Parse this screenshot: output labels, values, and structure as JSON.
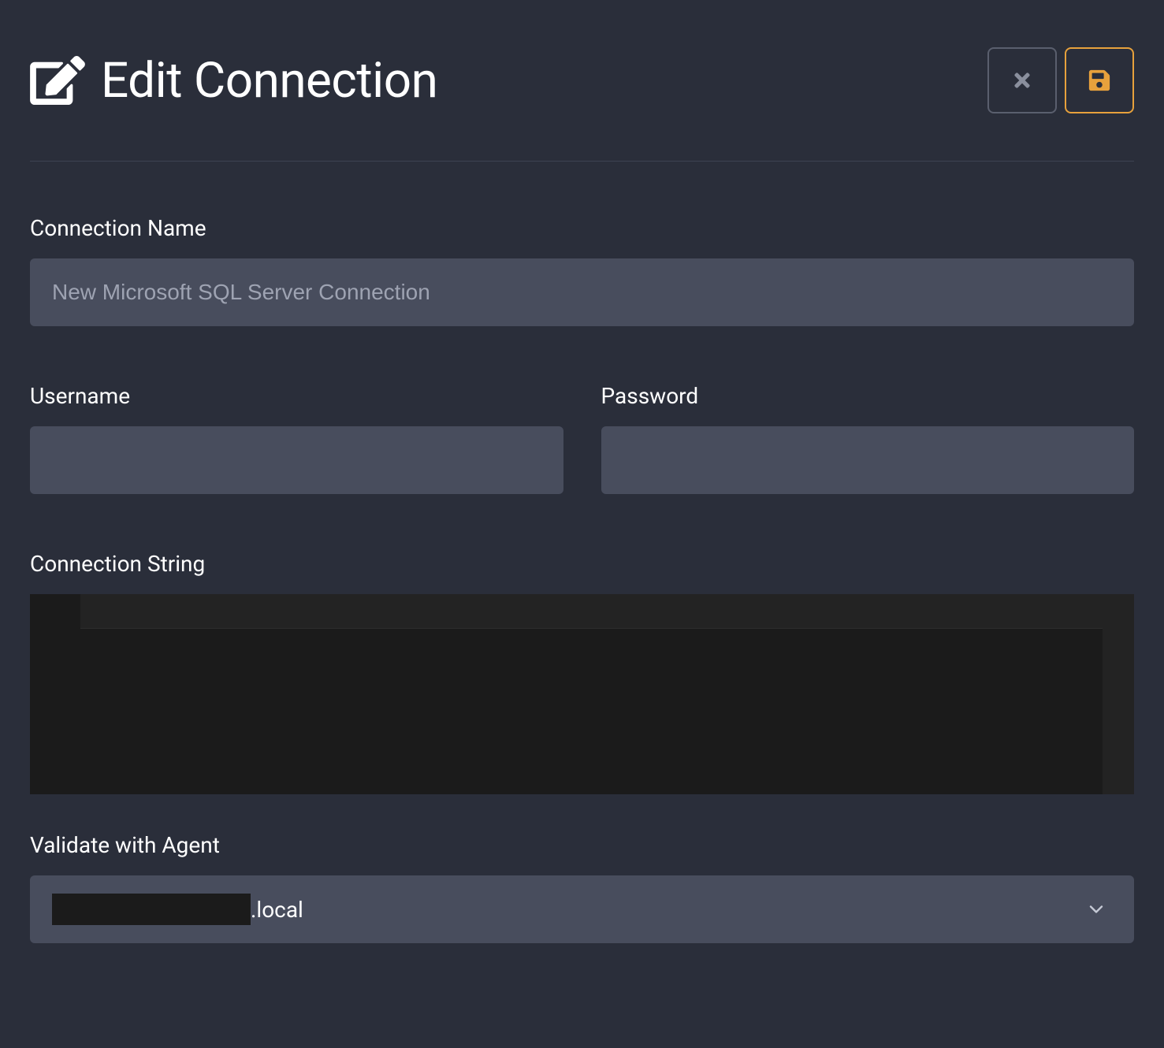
{
  "header": {
    "title": "Edit Connection"
  },
  "form": {
    "connectionName": {
      "label": "Connection Name",
      "value": "",
      "placeholder": "New Microsoft SQL Server Connection"
    },
    "username": {
      "label": "Username",
      "value": ""
    },
    "password": {
      "label": "Password",
      "value": ""
    },
    "connectionString": {
      "label": "Connection String",
      "value": ""
    },
    "validateWithAgent": {
      "label": "Validate with Agent",
      "selectedSuffix": ".local"
    }
  }
}
